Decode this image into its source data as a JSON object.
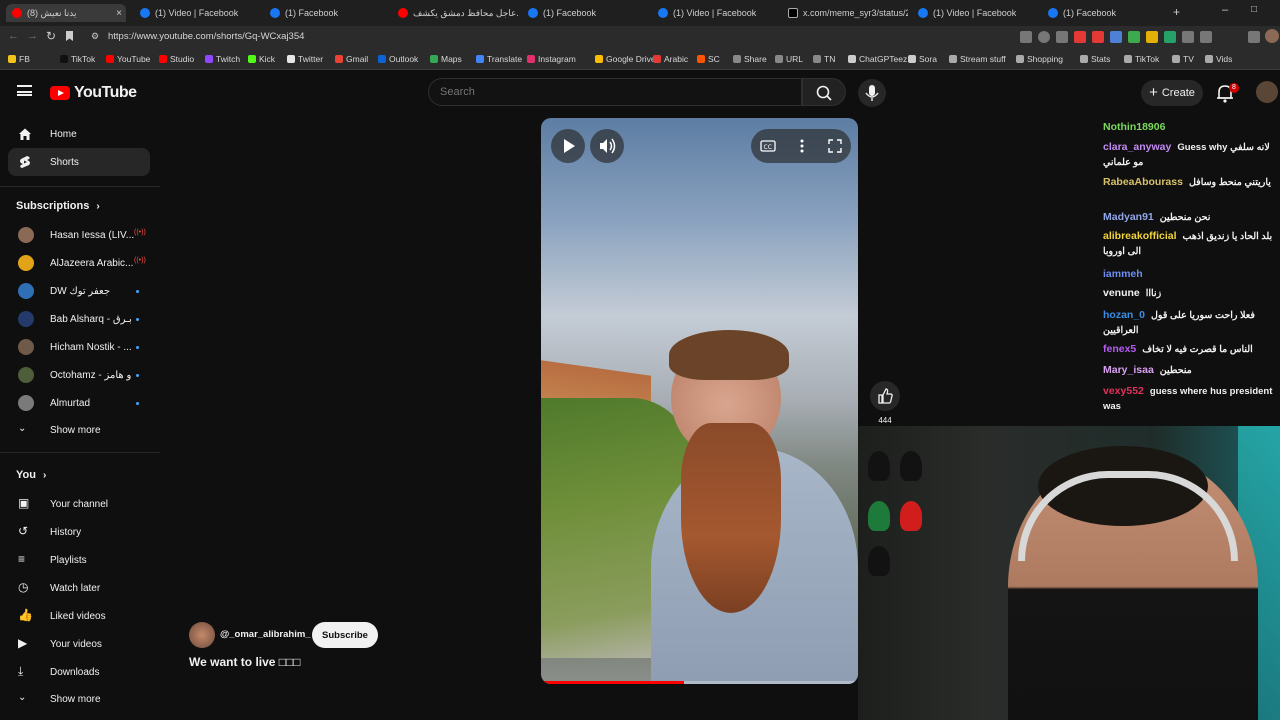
{
  "browser": {
    "tabs": [
      {
        "label": "(8) يدنا نعيش"
      },
      {
        "label": "(1) Video | Facebook"
      },
      {
        "label": "(1) Facebook"
      },
      {
        "label": "عاجل محافظ دمشق يكشف..."
      },
      {
        "label": "(1) Facebook"
      },
      {
        "label": "(1) Video | Facebook"
      },
      {
        "label": "x.com/meme_syr3/status/20"
      },
      {
        "label": "(1) Video | Facebook"
      },
      {
        "label": "(1) Facebook"
      }
    ],
    "url": "https://www.youtube.com/shorts/Gq-WCxaj354",
    "bookmarks": [
      {
        "label": "FB",
        "color": "#f0c419"
      },
      {
        "label": "TikTok",
        "color": "#111111"
      },
      {
        "label": "YouTube",
        "color": "#ff0000"
      },
      {
        "label": "Studio",
        "color": "#ff0000"
      },
      {
        "label": "Twitch",
        "color": "#9146ff"
      },
      {
        "label": "Kick",
        "color": "#53fc18"
      },
      {
        "label": "Twitter",
        "color": "#e7e7e7"
      },
      {
        "label": "Gmail",
        "color": "#ea4335"
      },
      {
        "label": "Outlook",
        "color": "#0a64d6"
      },
      {
        "label": "Maps",
        "color": "#34a853"
      },
      {
        "label": "Translate",
        "color": "#4285f4"
      },
      {
        "label": "Instagram",
        "color": "#e1306c"
      },
      {
        "label": "Google Drive",
        "color": "#fbbc04"
      },
      {
        "label": "Arabic",
        "color": "#e53935"
      },
      {
        "label": "SC",
        "color": "#ff5500"
      },
      {
        "label": "Share",
        "color": "#888888"
      },
      {
        "label": "URL",
        "color": "#888888"
      },
      {
        "label": "TN",
        "color": "#888888"
      },
      {
        "label": "ChatGPTeez",
        "color": "#cccccc"
      },
      {
        "label": "Sora",
        "color": "#cccccc"
      },
      {
        "label": "Stream stuff",
        "color": "#aaaaaa"
      },
      {
        "label": "Shopping",
        "color": "#aaaaaa"
      },
      {
        "label": "Stats",
        "color": "#aaaaaa"
      },
      {
        "label": "TikTok",
        "color": "#aaaaaa"
      },
      {
        "label": "TV",
        "color": "#aaaaaa"
      },
      {
        "label": "Vids",
        "color": "#aaaaaa"
      }
    ]
  },
  "header": {
    "logo_text": "YouTube",
    "search_placeholder": "Search",
    "create_label": "Create",
    "notification_count": "8"
  },
  "sidebar": {
    "main": [
      {
        "label": "Home",
        "icon": "home-icon"
      },
      {
        "label": "Shorts",
        "icon": "shorts-icon"
      }
    ],
    "subscriptions_heading": "Subscriptions",
    "subscriptions": [
      {
        "label": "Hasan Iessa (LIV...",
        "color": "#8b6a55",
        "status": "live"
      },
      {
        "label": "AlJazeera Arabic...",
        "color": "#e3a318",
        "status": "live"
      },
      {
        "label": "DW جعفر توك",
        "color": "#2f6fb5",
        "status": "new"
      },
      {
        "label": "Bab Alsharq - بـرق",
        "color": "#233a6b",
        "status": "new"
      },
      {
        "label": "Hicham Nostik - ...",
        "color": "#6f5a4a",
        "status": "new"
      },
      {
        "label": "Octohamz - و هامز",
        "color": "#4e5e3a",
        "status": "new"
      },
      {
        "label": "Almurtad",
        "color": "#7a7a7a",
        "status": "new"
      }
    ],
    "show_more_1": "Show more",
    "you_heading": "You",
    "you_items": [
      {
        "label": "Your channel",
        "icon": "user-box-icon"
      },
      {
        "label": "History",
        "icon": "history-icon"
      },
      {
        "label": "Playlists",
        "icon": "playlist-icon"
      },
      {
        "label": "Watch later",
        "icon": "clock-icon"
      },
      {
        "label": "Liked videos",
        "icon": "thumbs-up-icon"
      },
      {
        "label": "Your videos",
        "icon": "video-icon"
      },
      {
        "label": "Downloads",
        "icon": "download-icon"
      }
    ],
    "show_more_2": "Show more"
  },
  "short": {
    "channel": "@_omar_alibrahim_",
    "subscribe_label": "Subscribe",
    "title": "We want to live □□□",
    "like_count": "444",
    "progress": 0.45
  },
  "chat": [
    {
      "user": "Nothin18906",
      "color": "#7ad95b",
      "msg": ""
    },
    {
      "user": "clara_anyway",
      "color": "#c48bf2",
      "msg": "Guess why لانه سلفي مو علماني"
    },
    {
      "user": "RabeaAbourass",
      "color": "#d8c167",
      "msg": "ياريتني منحط وسافل"
    },
    {
      "user": "Madyan91",
      "color": "#8fa6e8",
      "msg": "نحن منحطين"
    },
    {
      "user": "alibreakofficial",
      "color": "#f2d43b",
      "msg": "بلد الحاد يا زنديق اذهب الى اوروبا"
    },
    {
      "user": "iammeh",
      "color": "#6e8ef2",
      "msg": ""
    },
    {
      "user": "venune",
      "color": "#f1f1f1",
      "msg": "زنااا"
    },
    {
      "user": "hozan_0",
      "color": "#3b8fe6",
      "msg": "فعلا راحت سوريا على قول العراقيين"
    },
    {
      "user": "fenex5",
      "color": "#b65cf2",
      "msg": "الناس ما قصرت فيه لا تخاف"
    },
    {
      "user": "Mary_isaa",
      "color": "#d9a0f2",
      "msg": "منحطين"
    },
    {
      "user": "vexy552",
      "color": "#e0325a",
      "msg": "guess where hus president was"
    }
  ]
}
